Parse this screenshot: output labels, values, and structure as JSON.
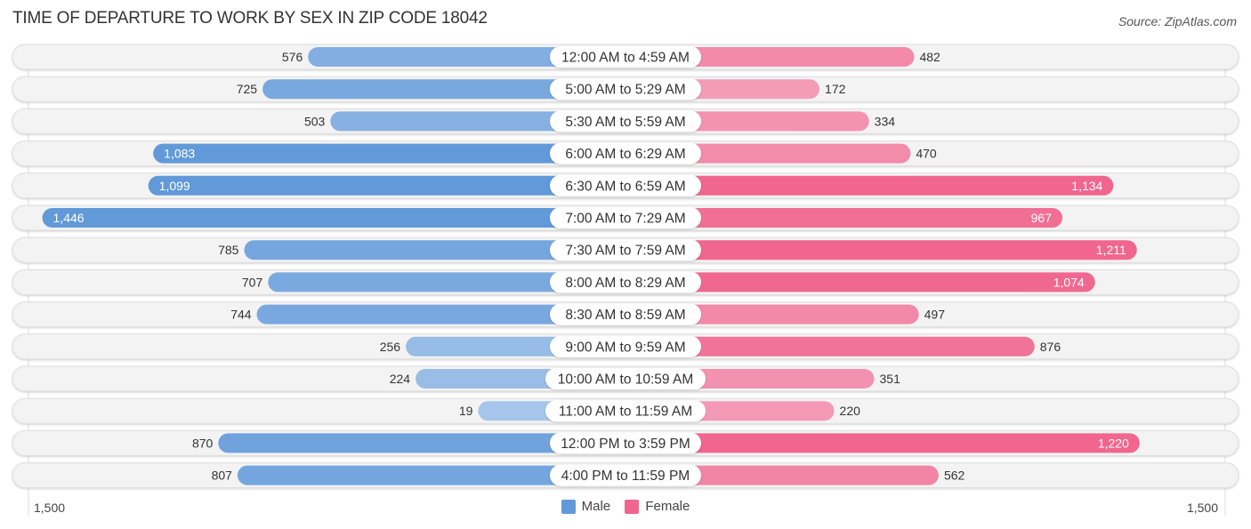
{
  "title": "TIME OF DEPARTURE TO WORK BY SEX IN ZIP CODE 18042",
  "source": "Source: ZipAtlas.com",
  "colors": {
    "male": "#6199d9",
    "male_light": "#a7c6ea",
    "female": "#f0668f",
    "female_light": "#f5a6bf",
    "row_bg": "#f3f3f3"
  },
  "chart_data": {
    "type": "bar",
    "orientation": "horizontal-diverging",
    "title": "TIME OF DEPARTURE TO WORK BY SEX IN ZIP CODE 18042",
    "categories": [
      "12:00 AM to 4:59 AM",
      "5:00 AM to 5:29 AM",
      "5:30 AM to 5:59 AM",
      "6:00 AM to 6:29 AM",
      "6:30 AM to 6:59 AM",
      "7:00 AM to 7:29 AM",
      "7:30 AM to 7:59 AM",
      "8:00 AM to 8:29 AM",
      "8:30 AM to 8:59 AM",
      "9:00 AM to 9:59 AM",
      "10:00 AM to 10:59 AM",
      "11:00 AM to 11:59 AM",
      "12:00 PM to 3:59 PM",
      "4:00 PM to 11:59 PM"
    ],
    "series": [
      {
        "name": "Male",
        "side": "left",
        "values": [
          576,
          725,
          503,
          1083,
          1099,
          1446,
          785,
          707,
          744,
          256,
          224,
          19,
          870,
          807
        ],
        "labels": [
          "576",
          "725",
          "503",
          "1,083",
          "1,099",
          "1,446",
          "785",
          "707",
          "744",
          "256",
          "224",
          "19",
          "870",
          "807"
        ]
      },
      {
        "name": "Female",
        "side": "right",
        "values": [
          482,
          172,
          334,
          470,
          1134,
          967,
          1211,
          1074,
          497,
          876,
          351,
          220,
          1220,
          562
        ],
        "labels": [
          "482",
          "172",
          "334",
          "470",
          "1,134",
          "967",
          "1,211",
          "1,074",
          "497",
          "876",
          "351",
          "220",
          "1,220",
          "562"
        ]
      }
    ],
    "xlim": [
      -1500,
      1500
    ],
    "axis_tick_labels": {
      "left": "1,500",
      "right": "1,500"
    },
    "legend": {
      "position": "bottom-center",
      "entries": [
        "Male",
        "Female"
      ]
    },
    "grid": false
  }
}
